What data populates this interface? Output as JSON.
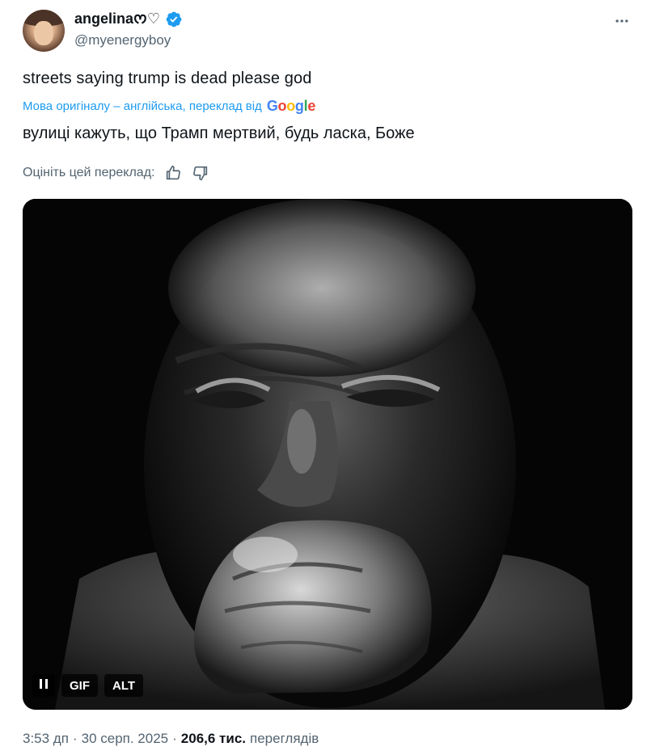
{
  "author": {
    "display_name": "angelina",
    "name_emoji": "ᰔ♡",
    "handle": "@myenergyboy",
    "verified": true
  },
  "tweet": {
    "text": "streets saying trump is dead please god",
    "translation_source": "Мова оригіналу – англійська, переклад від",
    "translator": "Google",
    "translated_text": "вулиці кажуть, що Трамп мертвий, будь ласка, Боже",
    "rate_label": "Оцініть цей переклад:"
  },
  "media": {
    "type": "gif",
    "description": "black and white close-up of a man with clasped hands pressed to his face",
    "controls": {
      "pause_icon": "pause-icon",
      "gif_label": "GIF",
      "alt_label": "ALT"
    }
  },
  "footer": {
    "time": "3:53 дп",
    "sep1": "·",
    "date": "30 серп. 2025",
    "sep2": "·",
    "views_count": "206,6 тис.",
    "views_label": "переглядів"
  },
  "colors": {
    "accent": "#1d9bf0",
    "text_primary": "#0f1419",
    "text_secondary": "#536471",
    "verified": "#1d9bf0"
  },
  "icons": [
    "verified-badge-icon",
    "more-options-icon",
    "thumbs-up-icon",
    "thumbs-down-icon",
    "pause-icon"
  ]
}
